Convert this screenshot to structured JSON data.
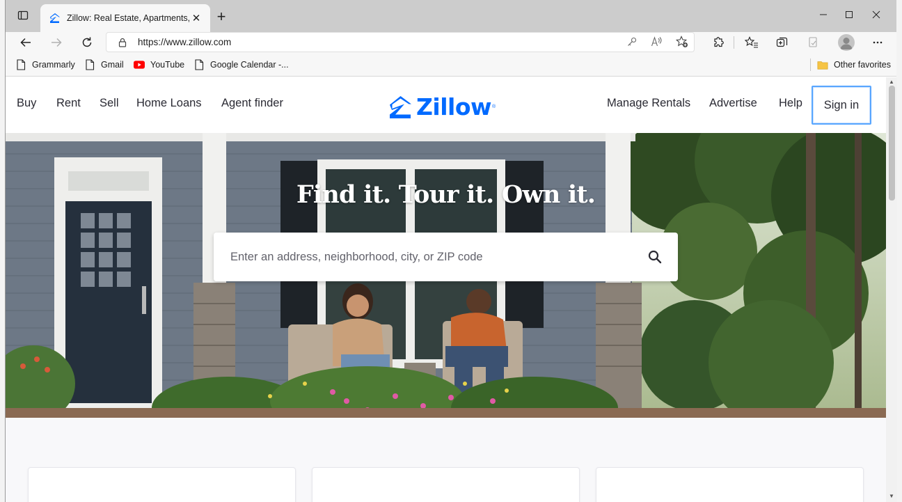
{
  "browser": {
    "tab": {
      "title": "Zillow: Real Estate, Apartments, M"
    },
    "address": {
      "url": "https://www.zillow.com"
    },
    "favorites": [
      {
        "label": "Grammarly",
        "icon": "page-icon"
      },
      {
        "label": "Gmail",
        "icon": "page-icon"
      },
      {
        "label": "YouTube",
        "icon": "youtube-icon"
      },
      {
        "label": "Google Calendar -...",
        "icon": "page-icon"
      }
    ],
    "other_favorites": "Other favorites"
  },
  "zillow": {
    "nav_left": [
      "Buy",
      "Rent",
      "Sell",
      "Home Loans",
      "Agent finder"
    ],
    "nav_right": [
      "Manage Rentals",
      "Advertise",
      "Help"
    ],
    "sign_in": "Sign in",
    "logo_text": "Zillow",
    "brand_color": "#006aff",
    "hero": {
      "title": "Find it. Tour it. Own it.",
      "search_placeholder": "Enter an address, neighborhood, city, or ZIP code"
    }
  }
}
